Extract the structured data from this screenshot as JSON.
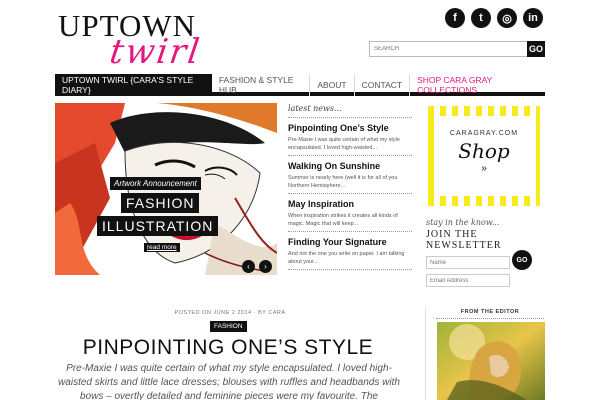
{
  "logo": {
    "top": "UPTOWN",
    "script": "twirl"
  },
  "social": [
    {
      "icon": "facebook-icon",
      "glyph": "f"
    },
    {
      "icon": "twitter-icon",
      "glyph": "t"
    },
    {
      "icon": "instagram-icon",
      "glyph": "◎"
    },
    {
      "icon": "linkedin-icon",
      "glyph": "in"
    }
  ],
  "search": {
    "placeholder": "SEARCH",
    "button": "GO"
  },
  "nav": [
    "UPTOWN TWIRL {CARA'S STYLE DIARY}",
    "FASHION & STYLE HUB",
    "ABOUT",
    "CONTACT",
    "SHOP CARA GRAY COLLECTIONS"
  ],
  "slider": {
    "tag": "Artwork Announcement",
    "title1": "FASHION",
    "title2": "ILLUSTRATION",
    "read_more": "read more",
    "prev": "‹",
    "next": "›"
  },
  "latest": {
    "heading": "latest news...",
    "items": [
      {
        "title": "Pinpointing One’s Style",
        "excerpt": "Pre-Maxie I was quite certain of what my style encapsulated. I loved high-waisted..."
      },
      {
        "title": "Walking On Sunshine",
        "excerpt": "Summer is nearly here (well it is for all of you Northern Hemisphere..."
      },
      {
        "title": "May Inspiration",
        "excerpt": "When inspiration strikes it creates all kinds of magic. Magic that will keep..."
      },
      {
        "title": "Finding Your Signature",
        "excerpt": "And not the one you write on paper. I am talking about your..."
      }
    ]
  },
  "ad": {
    "url": "CARAGRAY.COM",
    "shop": "Shop",
    "arrow": "»"
  },
  "newsletter": {
    "small": "stay in the know...",
    "title": "JOIN THE NEWSLETTER",
    "name_placeholder": "Name",
    "email_placeholder": "Email Address",
    "button": "GO"
  },
  "post": {
    "meta": "POSTED ON JUNE 2 2014 · BY CARA",
    "category": "FASHION",
    "title": "PINPOINTING ONE’S STYLE",
    "excerpt": "Pre-Maxie I was quite certain of what my style encapsulated. I loved high-waisted skirts and little lace dresses; blouses with ruffles and headbands with bows – overtly detailed and feminine pieces were my favourite. The"
  },
  "editor": {
    "label": "FROM THE EDITOR"
  },
  "colors": {
    "accent": "#e4197f",
    "dark": "#111111",
    "ad_yellow": "#f7ea1a"
  }
}
